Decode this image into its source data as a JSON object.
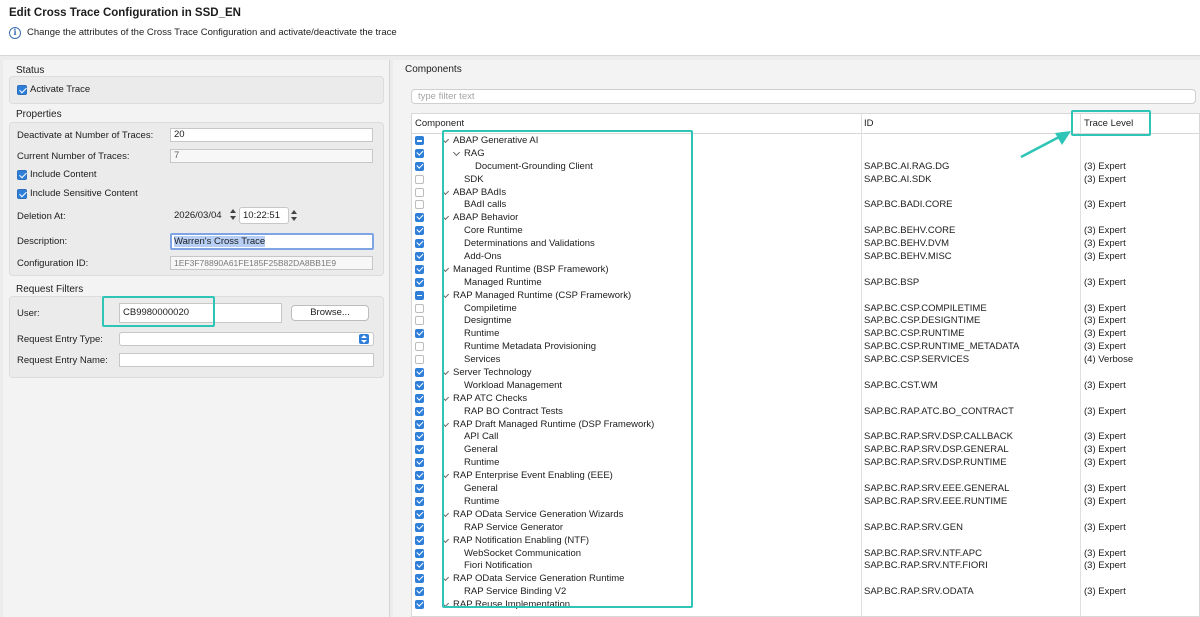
{
  "header": {
    "title": "Edit Cross Trace Configuration in SSD_EN",
    "subtitle": "Change the attributes of the Cross Trace Configuration and activate/deactivate the trace",
    "info_glyph": "i"
  },
  "status": {
    "section_label": "Status",
    "activate_trace_label": "Activate Trace",
    "activate_trace_checked": true
  },
  "properties": {
    "section_label": "Properties",
    "deactivate_label": "Deactivate at Number of Traces:",
    "deactivate_value": "20",
    "current_label": "Current Number of Traces:",
    "current_value": "7",
    "include_content_label": "Include Content",
    "include_content_checked": true,
    "include_sensitive_label": "Include Sensitive Content",
    "include_sensitive_checked": true,
    "deletion_label": "Deletion At:",
    "deletion_date": "2026/03/04",
    "deletion_time": "10:22:51",
    "description_label": "Description:",
    "description_value": "Warren's Cross Trace",
    "config_id_label": "Configuration ID:",
    "config_id_value": "1EF3F78890A61FE185F25B82DA8BB1E9"
  },
  "request_filters": {
    "section_label": "Request Filters",
    "user_label": "User:",
    "user_value": "CB9980000020",
    "browse_label": "Browse...",
    "entry_type_label": "Request Entry Type:",
    "entry_type_value": "",
    "entry_name_label": "Request Entry Name:",
    "entry_name_value": ""
  },
  "components": {
    "section_label": "Components",
    "filter_placeholder": "type filter text",
    "columns": {
      "component": "Component",
      "id": "ID",
      "trace_level": "Trace Level"
    },
    "rows": [
      {
        "name": "ABAP Generative AI",
        "level": 0,
        "state": "mixed",
        "expanded": true,
        "id": "",
        "trace": ""
      },
      {
        "name": "RAG",
        "level": 1,
        "state": "checked",
        "expanded": true,
        "id": "",
        "trace": ""
      },
      {
        "name": "Document-Grounding Client",
        "level": 2,
        "state": "checked",
        "id": "SAP.BC.AI.RAG.DG",
        "trace": "(3) Expert"
      },
      {
        "name": "SDK",
        "level": 1,
        "state": "unchecked",
        "id": "SAP.BC.AI.SDK",
        "trace": "(3) Expert"
      },
      {
        "name": "ABAP BAdIs",
        "level": 0,
        "state": "unchecked",
        "expanded": true,
        "id": "",
        "trace": ""
      },
      {
        "name": "BAdI calls",
        "level": 1,
        "state": "unchecked",
        "id": "SAP.BC.BADI.CORE",
        "trace": "(3) Expert"
      },
      {
        "name": "ABAP Behavior",
        "level": 0,
        "state": "checked",
        "expanded": true,
        "id": "",
        "trace": ""
      },
      {
        "name": "Core Runtime",
        "level": 1,
        "state": "checked",
        "id": "SAP.BC.BEHV.CORE",
        "trace": "(3) Expert"
      },
      {
        "name": "Determinations and Validations",
        "level": 1,
        "state": "checked",
        "id": "SAP.BC.BEHV.DVM",
        "trace": "(3) Expert"
      },
      {
        "name": "Add-Ons",
        "level": 1,
        "state": "checked",
        "id": "SAP.BC.BEHV.MISC",
        "trace": "(3) Expert"
      },
      {
        "name": "Managed Runtime (BSP Framework)",
        "level": 0,
        "state": "checked",
        "expanded": true,
        "id": "",
        "trace": ""
      },
      {
        "name": "Managed Runtime",
        "level": 1,
        "state": "checked",
        "id": "SAP.BC.BSP",
        "trace": "(3) Expert"
      },
      {
        "name": "RAP Managed Runtime (CSP Framework)",
        "level": 0,
        "state": "mixed",
        "expanded": true,
        "id": "",
        "trace": ""
      },
      {
        "name": "Compiletime",
        "level": 1,
        "state": "unchecked",
        "id": "SAP.BC.CSP.COMPILETIME",
        "trace": "(3) Expert"
      },
      {
        "name": "Designtime",
        "level": 1,
        "state": "unchecked",
        "id": "SAP.BC.CSP.DESIGNTIME",
        "trace": "(3) Expert"
      },
      {
        "name": "Runtime",
        "level": 1,
        "state": "checked",
        "id": "SAP.BC.CSP.RUNTIME",
        "trace": "(3) Expert"
      },
      {
        "name": "Runtime Metadata Provisioning",
        "level": 1,
        "state": "unchecked",
        "id": "SAP.BC.CSP.RUNTIME_METADATA",
        "trace": "(3) Expert"
      },
      {
        "name": "Services",
        "level": 1,
        "state": "unchecked",
        "id": "SAP.BC.CSP.SERVICES",
        "trace": "(4) Verbose"
      },
      {
        "name": "Server Technology",
        "level": 0,
        "state": "checked",
        "expanded": true,
        "id": "",
        "trace": ""
      },
      {
        "name": "Workload Management",
        "level": 1,
        "state": "checked",
        "id": "SAP.BC.CST.WM",
        "trace": "(3) Expert"
      },
      {
        "name": "RAP ATC Checks",
        "level": 0,
        "state": "checked",
        "expanded": true,
        "id": "",
        "trace": ""
      },
      {
        "name": "RAP BO Contract Tests",
        "level": 1,
        "state": "checked",
        "id": "SAP.BC.RAP.ATC.BO_CONTRACT",
        "trace": "(3) Expert"
      },
      {
        "name": "RAP Draft Managed Runtime (DSP Framework)",
        "level": 0,
        "state": "checked",
        "expanded": true,
        "id": "",
        "trace": ""
      },
      {
        "name": "API Call",
        "level": 1,
        "state": "checked",
        "id": "SAP.BC.RAP.SRV.DSP.CALLBACK",
        "trace": "(3) Expert"
      },
      {
        "name": "General",
        "level": 1,
        "state": "checked",
        "id": "SAP.BC.RAP.SRV.DSP.GENERAL",
        "trace": "(3) Expert"
      },
      {
        "name": "Runtime",
        "level": 1,
        "state": "checked",
        "id": "SAP.BC.RAP.SRV.DSP.RUNTIME",
        "trace": "(3) Expert"
      },
      {
        "name": "RAP Enterprise Event Enabling (EEE)",
        "level": 0,
        "state": "checked",
        "expanded": true,
        "id": "",
        "trace": ""
      },
      {
        "name": "General",
        "level": 1,
        "state": "checked",
        "id": "SAP.BC.RAP.SRV.EEE.GENERAL",
        "trace": "(3) Expert"
      },
      {
        "name": "Runtime",
        "level": 1,
        "state": "checked",
        "id": "SAP.BC.RAP.SRV.EEE.RUNTIME",
        "trace": "(3) Expert"
      },
      {
        "name": "RAP OData Service Generation Wizards",
        "level": 0,
        "state": "checked",
        "expanded": true,
        "id": "",
        "trace": ""
      },
      {
        "name": "RAP Service Generator",
        "level": 1,
        "state": "checked",
        "id": "SAP.BC.RAP.SRV.GEN",
        "trace": "(3) Expert"
      },
      {
        "name": "RAP Notification Enabling (NTF)",
        "level": 0,
        "state": "checked",
        "expanded": true,
        "id": "",
        "trace": ""
      },
      {
        "name": "WebSocket Communication",
        "level": 1,
        "state": "checked",
        "id": "SAP.BC.RAP.SRV.NTF.APC",
        "trace": "(3) Expert"
      },
      {
        "name": "Fiori Notification",
        "level": 1,
        "state": "checked",
        "id": "SAP.BC.RAP.SRV.NTF.FIORI",
        "trace": "(3) Expert"
      },
      {
        "name": "RAP OData Service Generation Runtime",
        "level": 0,
        "state": "checked",
        "expanded": true,
        "id": "",
        "trace": ""
      },
      {
        "name": "RAP Service Binding V2",
        "level": 1,
        "state": "checked",
        "id": "SAP.BC.RAP.SRV.ODATA",
        "trace": "(3) Expert"
      },
      {
        "name": "RAP Reuse Implementation",
        "level": 0,
        "state": "checked",
        "expanded": true,
        "id": "",
        "trace": ""
      }
    ]
  },
  "colors": {
    "accent_blue": "#2f7fd9",
    "highlight_teal": "#2ec4b6"
  }
}
